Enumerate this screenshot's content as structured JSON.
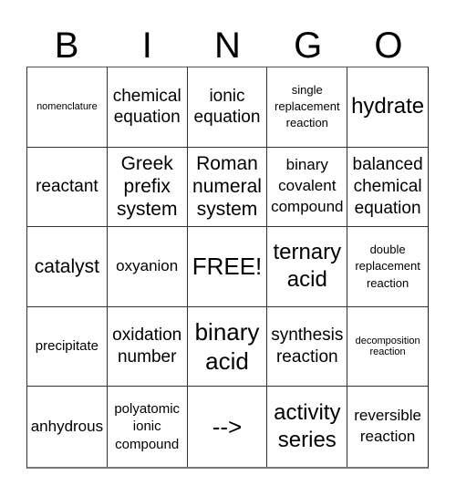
{
  "header": {
    "letters": [
      "B",
      "I",
      "N",
      "G",
      "O"
    ]
  },
  "cells": [
    "nomenclature",
    "chemical equation",
    "ionic equation",
    "single replacement reaction",
    "hydrate",
    "reactant",
    "Greek prefix system",
    "Roman numeral system",
    "binary covalent compound",
    "balanced chemical equation",
    "catalyst",
    "oxyanion",
    "FREE!",
    "ternary acid",
    "double replacement reaction",
    "precipitate",
    "oxidation number",
    "binary acid",
    "synthesis reaction",
    "decomposition reaction",
    "anhydrous",
    "polyatomic ionic compound",
    "-->",
    "activity series",
    "reversible reaction"
  ]
}
